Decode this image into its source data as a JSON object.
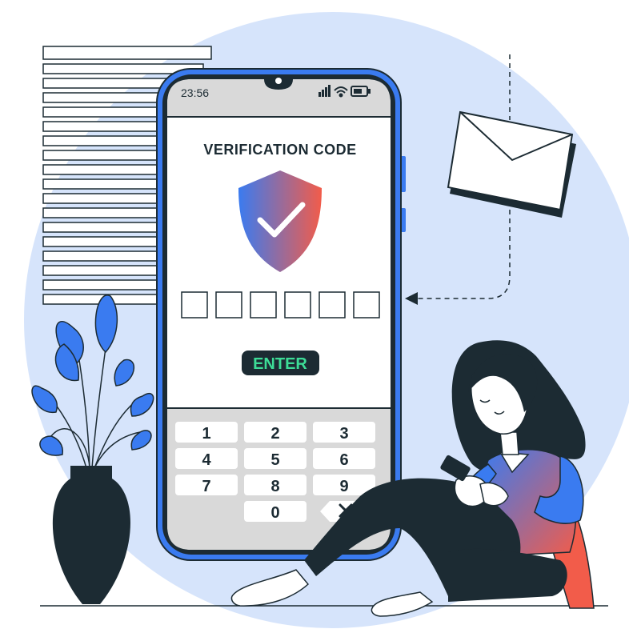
{
  "status_bar": {
    "time": "23:56"
  },
  "screen": {
    "title": "VERIFICATION CODE",
    "code_slots": 6,
    "enter_label": "ENTER"
  },
  "keypad": {
    "keys": [
      "1",
      "2",
      "3",
      "4",
      "5",
      "6",
      "7",
      "8",
      "9",
      "",
      "0",
      "⌫"
    ]
  },
  "colors": {
    "circle_bg": "#d6e4fb",
    "phone_frame": "#3a7bf0",
    "dark": "#1c2b33",
    "accent_blue": "#3a7bf0",
    "accent_red": "#f25c4a",
    "enter_text": "#3ddc97"
  },
  "icons": [
    "shield-check-icon",
    "signal-icon",
    "wifi-icon",
    "battery-icon",
    "envelope-icon",
    "backspace-icon"
  ]
}
